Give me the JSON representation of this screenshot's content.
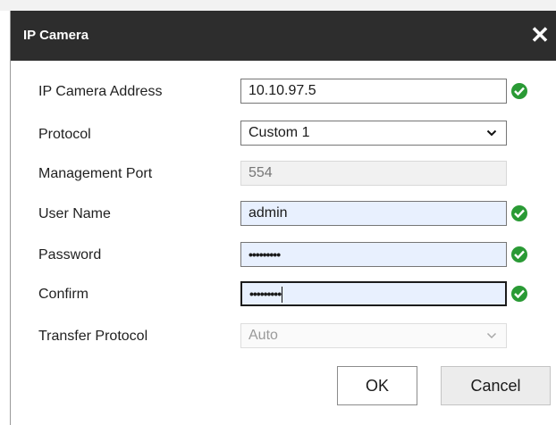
{
  "dialog": {
    "title": "IP Camera",
    "close_glyph": "✕"
  },
  "form": {
    "ip_address": {
      "label": "IP Camera Address",
      "value": "10.10.97.5",
      "valid": true
    },
    "protocol": {
      "label": "Protocol",
      "value": "Custom 1"
    },
    "management_port": {
      "label": "Management Port",
      "value": "554"
    },
    "user_name": {
      "label": "User Name",
      "value": "admin",
      "valid": true
    },
    "password": {
      "label": "Password",
      "value": "•••••••••",
      "valid": true
    },
    "confirm": {
      "label": "Confirm",
      "value": "•••••••••",
      "valid": true
    },
    "transfer_protocol": {
      "label": "Transfer Protocol",
      "value": "Auto"
    }
  },
  "buttons": {
    "ok_label": "OK",
    "cancel_label": "Cancel"
  },
  "colors": {
    "title_bar": "#2d2d2d",
    "valid_check": "#2a9a35",
    "autofill_bg": "#e8f0fe"
  },
  "icons": [
    "close-icon",
    "check-icon",
    "chevron-down-icon"
  ]
}
